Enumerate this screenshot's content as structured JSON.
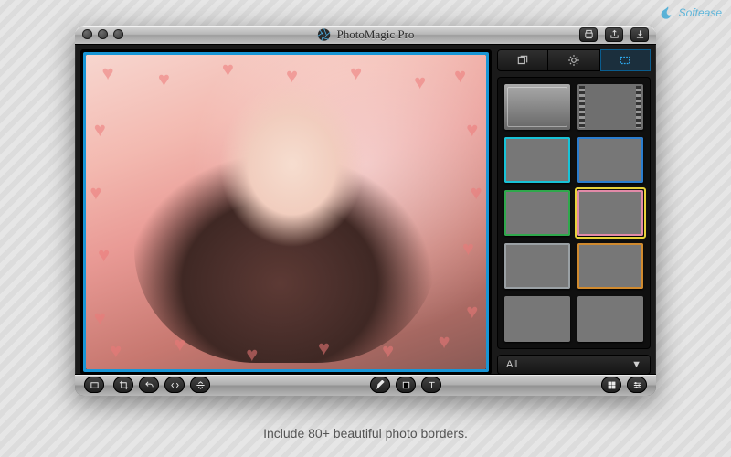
{
  "watermark": {
    "text": "Softease"
  },
  "app": {
    "title": "PhotoMagic Pro"
  },
  "titlebar_actions": {
    "print": "print-icon",
    "share": "share-icon",
    "download": "download-icon"
  },
  "side_tabs": {
    "layers": "layers",
    "adjust": "adjust",
    "frames": "frames",
    "active": "frames"
  },
  "frames_grid": {
    "items": [
      {
        "name": "frame-fade",
        "style": "tb-fade",
        "selected": false
      },
      {
        "name": "frame-film",
        "style": "tb-film",
        "selected": false
      },
      {
        "name": "frame-cyan",
        "style": "tb-cyan",
        "selected": false
      },
      {
        "name": "frame-blue",
        "style": "tb-blue",
        "selected": false
      },
      {
        "name": "frame-green",
        "style": "tb-green",
        "selected": false
      },
      {
        "name": "frame-pink",
        "style": "tb-pink",
        "selected": true
      },
      {
        "name": "frame-gray",
        "style": "tb-gray",
        "selected": false
      },
      {
        "name": "frame-orange",
        "style": "tb-orange",
        "selected": false
      },
      {
        "name": "frame-plain-1",
        "style": "",
        "selected": false
      },
      {
        "name": "frame-plain-2",
        "style": "",
        "selected": false
      }
    ]
  },
  "filter_dropdown": {
    "value": "All"
  },
  "bottom_tools": {
    "left": [
      "fit-screen"
    ],
    "g1": [
      "crop",
      "undo",
      "flip-h",
      "flip-v"
    ],
    "g2": [
      "brush",
      "fill",
      "text"
    ],
    "g3": [
      "grid",
      "settings"
    ]
  },
  "caption": "Include 80+ beautiful photo borders."
}
